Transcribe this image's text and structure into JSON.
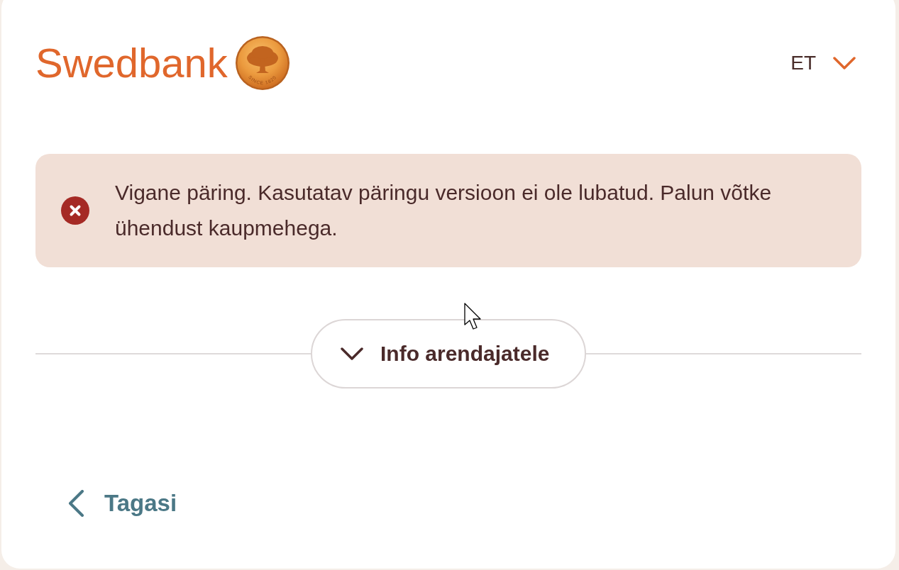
{
  "header": {
    "logo": {
      "wordmark": "Swedbank",
      "seal_text": "SINCE 1820"
    },
    "language": {
      "label": "ET"
    }
  },
  "alert": {
    "kind": "error",
    "message": "Vigane päring. Kasutatav päringu versioon ei ole lubatud. Palun võtke ühendust kaupmehega."
  },
  "developer_info": {
    "label": "Info arendajatele",
    "expanded": false
  },
  "back_link": {
    "label": "Tagasi"
  }
}
